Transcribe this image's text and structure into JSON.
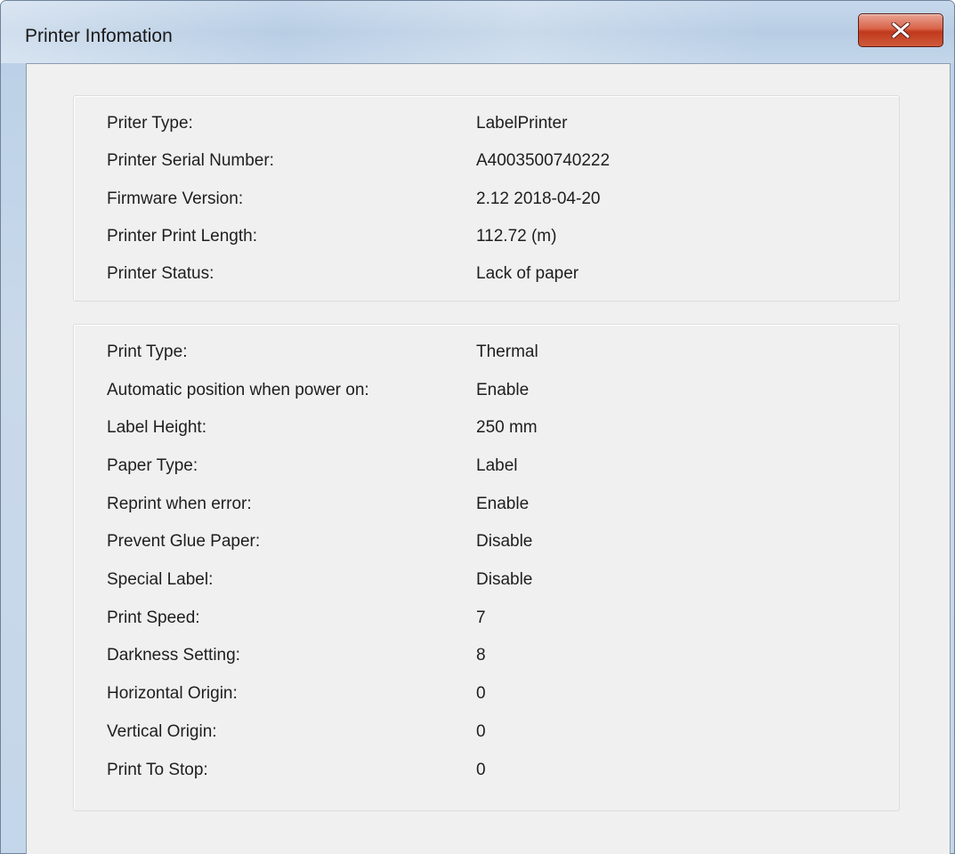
{
  "window": {
    "title": "Printer Infomation"
  },
  "printer_info": [
    {
      "label": "Priter Type:",
      "value": "LabelPrinter"
    },
    {
      "label": "Printer Serial Number:",
      "value": "A4003500740222"
    },
    {
      "label": "Firmware Version:",
      "value": "2.12 2018-04-20"
    },
    {
      "label": "Printer Print Length:",
      "value": "112.72 (m)"
    },
    {
      "label": "Printer Status:",
      "value": "Lack of paper"
    }
  ],
  "print_settings": [
    {
      "label": "Print Type:",
      "value": "Thermal"
    },
    {
      "label": "Automatic position when power on:",
      "value": "Enable"
    },
    {
      "label": "Label Height:",
      "value": "250 mm"
    },
    {
      "label": "Paper Type:",
      "value": "Label"
    },
    {
      "label": "Reprint when error:",
      "value": "Enable"
    },
    {
      "label": "Prevent Glue Paper:",
      "value": "Disable"
    },
    {
      "label": "Special Label:",
      "value": "Disable"
    },
    {
      "label": "Print Speed:",
      "value": "7"
    },
    {
      "label": "Darkness Setting:",
      "value": "8"
    },
    {
      "label": "Horizontal Origin:",
      "value": "0"
    },
    {
      "label": "Vertical Origin:",
      "value": "0"
    },
    {
      "label": "Print To Stop:",
      "value": "0"
    }
  ]
}
